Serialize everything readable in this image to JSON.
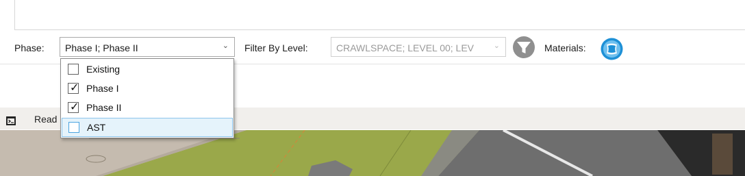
{
  "filters": {
    "phase_label": "Phase:",
    "phase_value": "Phase I; Phase II",
    "level_label": "Filter By Level:",
    "level_value": "CRAWLSPACE; LEVEL 00; LEV",
    "materials_label": "Materials:",
    "icons": {
      "filter": "funnel-icon",
      "materials": "material-swatch-icon",
      "dropdown": "chevron-down-icon"
    }
  },
  "phase_dropdown": {
    "options": [
      {
        "label": "Existing",
        "checked": false,
        "hovered": false
      },
      {
        "label": "Phase I",
        "checked": true,
        "hovered": false
      },
      {
        "label": "Phase II",
        "checked": true,
        "hovered": false
      },
      {
        "label": "AST",
        "checked": false,
        "hovered": true
      }
    ],
    "check_glyph": "✓"
  },
  "status_bar": {
    "text": "Read"
  },
  "colors": {
    "accent": "#1e90d6",
    "hover_bg": "#e5f3fb",
    "hover_border": "#8cc4eb",
    "funnel_gray": "#8f8f8f",
    "ground_green": "#9aa84a"
  }
}
